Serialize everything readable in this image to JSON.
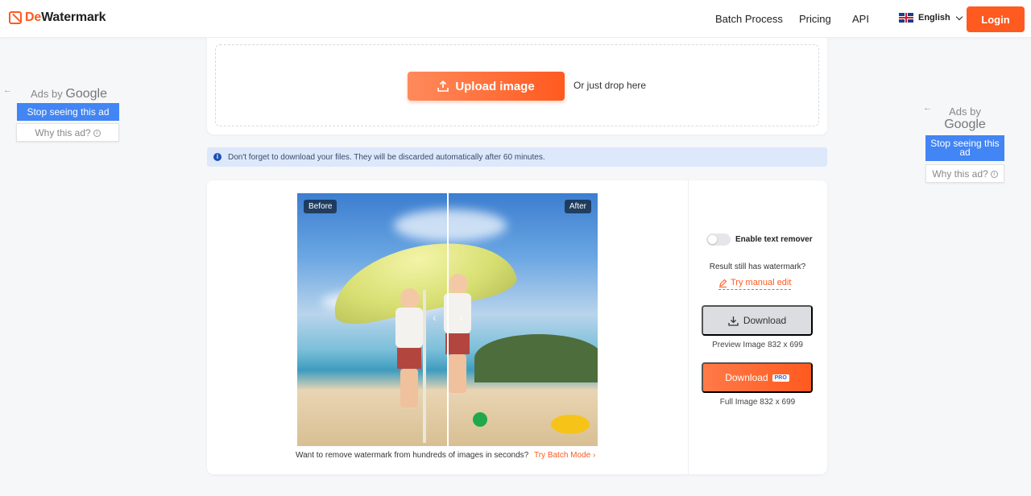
{
  "header": {
    "logo_prefix": "De",
    "logo_suffix": "Watermark",
    "nav": [
      "Batch Process",
      "Pricing",
      "API"
    ],
    "language": "English",
    "login_label": "Login"
  },
  "ads": {
    "left": {
      "ads_by": "Ads by",
      "google": "Google",
      "stop": "Stop seeing this ad",
      "why": "Why this ad?"
    },
    "right": {
      "ads_by": "Ads by",
      "google": "Google",
      "stop": "Stop seeing this ad",
      "why": "Why this ad?"
    }
  },
  "upload": {
    "button_label": "Upload image",
    "drop_text": "Or just drop here"
  },
  "notice": {
    "text": "Don't forget to download your files. They will be discarded automatically after 60 minutes."
  },
  "compare": {
    "before_label": "Before",
    "after_label": "After"
  },
  "batch": {
    "text": "Want to remove watermark from hundreds of images in seconds?",
    "link": "Try Batch Mode"
  },
  "panel": {
    "toggle_label": "Enable text remover",
    "toggle_on": false,
    "still_text": "Result still has watermark?",
    "manual_edit": "Try manual edit",
    "download_label": "Download",
    "preview_meta": "Preview Image 832 x 699",
    "download_full_label": "Download",
    "pro_badge": "PRO",
    "full_meta": "Full Image 832 x 699"
  },
  "colors": {
    "accent": "#ff5a1f",
    "ad_blue": "#4285f4",
    "notice_bg": "#dde8fb"
  }
}
